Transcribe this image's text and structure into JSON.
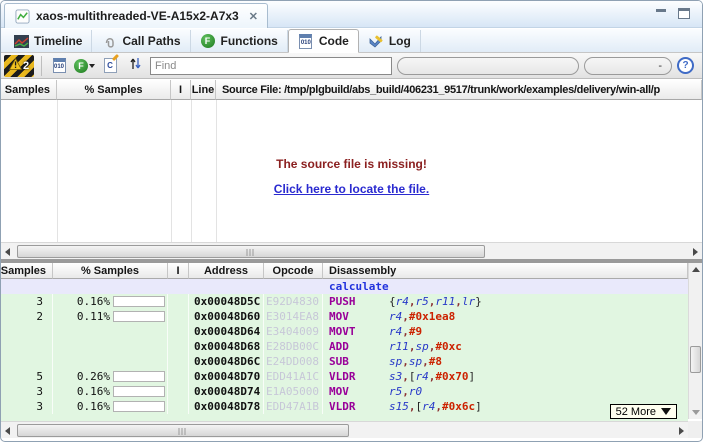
{
  "editor_tab": {
    "label": "xaos-multithreaded-VE-A15x2-A7x3",
    "close_glyph": "✕"
  },
  "view_tabs": {
    "active": "Code",
    "items": [
      {
        "label": "Timeline"
      },
      {
        "label": "Call Paths"
      },
      {
        "label": "Functions"
      },
      {
        "label": "Code"
      },
      {
        "label": "Log"
      }
    ]
  },
  "toolbar": {
    "warning_badge": "2",
    "find_placeholder": "Find",
    "range_value": "-",
    "help_glyph": "?"
  },
  "icons": {
    "functions_glyph": "F",
    "code_glyph": "010",
    "c_source_glyph": "C"
  },
  "source_panel": {
    "columns": [
      "Samples",
      "% Samples",
      "I",
      "Line",
      "Source File: /tmp/plgbuild/abs_build/406231_9517/trunk/work/examples/delivery/win-all/p"
    ],
    "missing_message": "The source file is missing!",
    "locate_link": "Click here to locate the file."
  },
  "disasm_panel": {
    "columns": [
      "Samples",
      "% Samples",
      "I",
      "Address",
      "Opcode",
      "Disassembly"
    ],
    "function_label": "calculate",
    "more_button": "52 More",
    "rows": [
      {
        "samples": "3",
        "pct": "0.16%",
        "address": "0x00048D5C",
        "opcode": "E92D4830",
        "mnemonic": "PUSH",
        "operands": [
          {
            "t": "{",
            "k": "pn"
          },
          {
            "t": "r4",
            "k": "reg"
          },
          {
            "t": ",",
            "k": "cm"
          },
          {
            "t": "r5",
            "k": "reg"
          },
          {
            "t": ",",
            "k": "cm"
          },
          {
            "t": "r11",
            "k": "reg"
          },
          {
            "t": ",",
            "k": "cm"
          },
          {
            "t": "lr",
            "k": "reg"
          },
          {
            "t": "}",
            "k": "pn"
          }
        ]
      },
      {
        "samples": "2",
        "pct": "0.11%",
        "address": "0x00048D60",
        "opcode": "E3014EA8",
        "mnemonic": "MOV",
        "operands": [
          {
            "t": "r4",
            "k": "reg"
          },
          {
            "t": ",",
            "k": "cm"
          },
          {
            "t": "#0x1ea8",
            "k": "imm"
          }
        ]
      },
      {
        "samples": "",
        "pct": "",
        "address": "0x00048D64",
        "opcode": "E3404009",
        "mnemonic": "MOVT",
        "operands": [
          {
            "t": "r4",
            "k": "reg"
          },
          {
            "t": ",",
            "k": "cm"
          },
          {
            "t": "#9",
            "k": "imm"
          }
        ]
      },
      {
        "samples": "",
        "pct": "",
        "address": "0x00048D68",
        "opcode": "E28DB00C",
        "mnemonic": "ADD",
        "operands": [
          {
            "t": "r11",
            "k": "reg"
          },
          {
            "t": ",",
            "k": "cm"
          },
          {
            "t": "sp",
            "k": "reg"
          },
          {
            "t": ",",
            "k": "cm"
          },
          {
            "t": "#0xc",
            "k": "imm"
          }
        ]
      },
      {
        "samples": "",
        "pct": "",
        "address": "0x00048D6C",
        "opcode": "E24DD008",
        "mnemonic": "SUB",
        "operands": [
          {
            "t": "sp",
            "k": "reg"
          },
          {
            "t": ",",
            "k": "cm"
          },
          {
            "t": "sp",
            "k": "reg"
          },
          {
            "t": ",",
            "k": "cm"
          },
          {
            "t": "#8",
            "k": "imm"
          }
        ]
      },
      {
        "samples": "5",
        "pct": "0.26%",
        "address": "0x00048D70",
        "opcode": "EDD41A1C",
        "mnemonic": "VLDR",
        "operands": [
          {
            "t": "s3",
            "k": "reg"
          },
          {
            "t": ",",
            "k": "cm"
          },
          {
            "t": "[",
            "k": "pn"
          },
          {
            "t": "r4",
            "k": "reg"
          },
          {
            "t": ",",
            "k": "cm"
          },
          {
            "t": "#0x70",
            "k": "imm"
          },
          {
            "t": "]",
            "k": "pn"
          }
        ]
      },
      {
        "samples": "3",
        "pct": "0.16%",
        "address": "0x00048D74",
        "opcode": "E1A05000",
        "mnemonic": "MOV",
        "operands": [
          {
            "t": "r5",
            "k": "reg"
          },
          {
            "t": ",",
            "k": "cm"
          },
          {
            "t": "r0",
            "k": "reg"
          }
        ]
      },
      {
        "samples": "3",
        "pct": "0.16%",
        "address": "0x00048D78",
        "opcode": "EDD47A1B",
        "mnemonic": "VLDR",
        "operands": [
          {
            "t": "s15",
            "k": "reg"
          },
          {
            "t": ",",
            "k": "cm"
          },
          {
            "t": "[",
            "k": "pn"
          },
          {
            "t": "r4",
            "k": "reg"
          },
          {
            "t": ",",
            "k": "cm"
          },
          {
            "t": "#0x6c",
            "k": "imm"
          },
          {
            "t": "]",
            "k": "pn"
          }
        ]
      }
    ]
  },
  "colors": {
    "missing_red": "#8b2020",
    "link_blue": "#2a2ad0",
    "mnemonic_purple": "#990099",
    "register_blue": "#2738c8",
    "immediate_red": "#cc2200",
    "row_green": "#e1f6e1",
    "function_row_lavender": "#e9e9fb"
  }
}
